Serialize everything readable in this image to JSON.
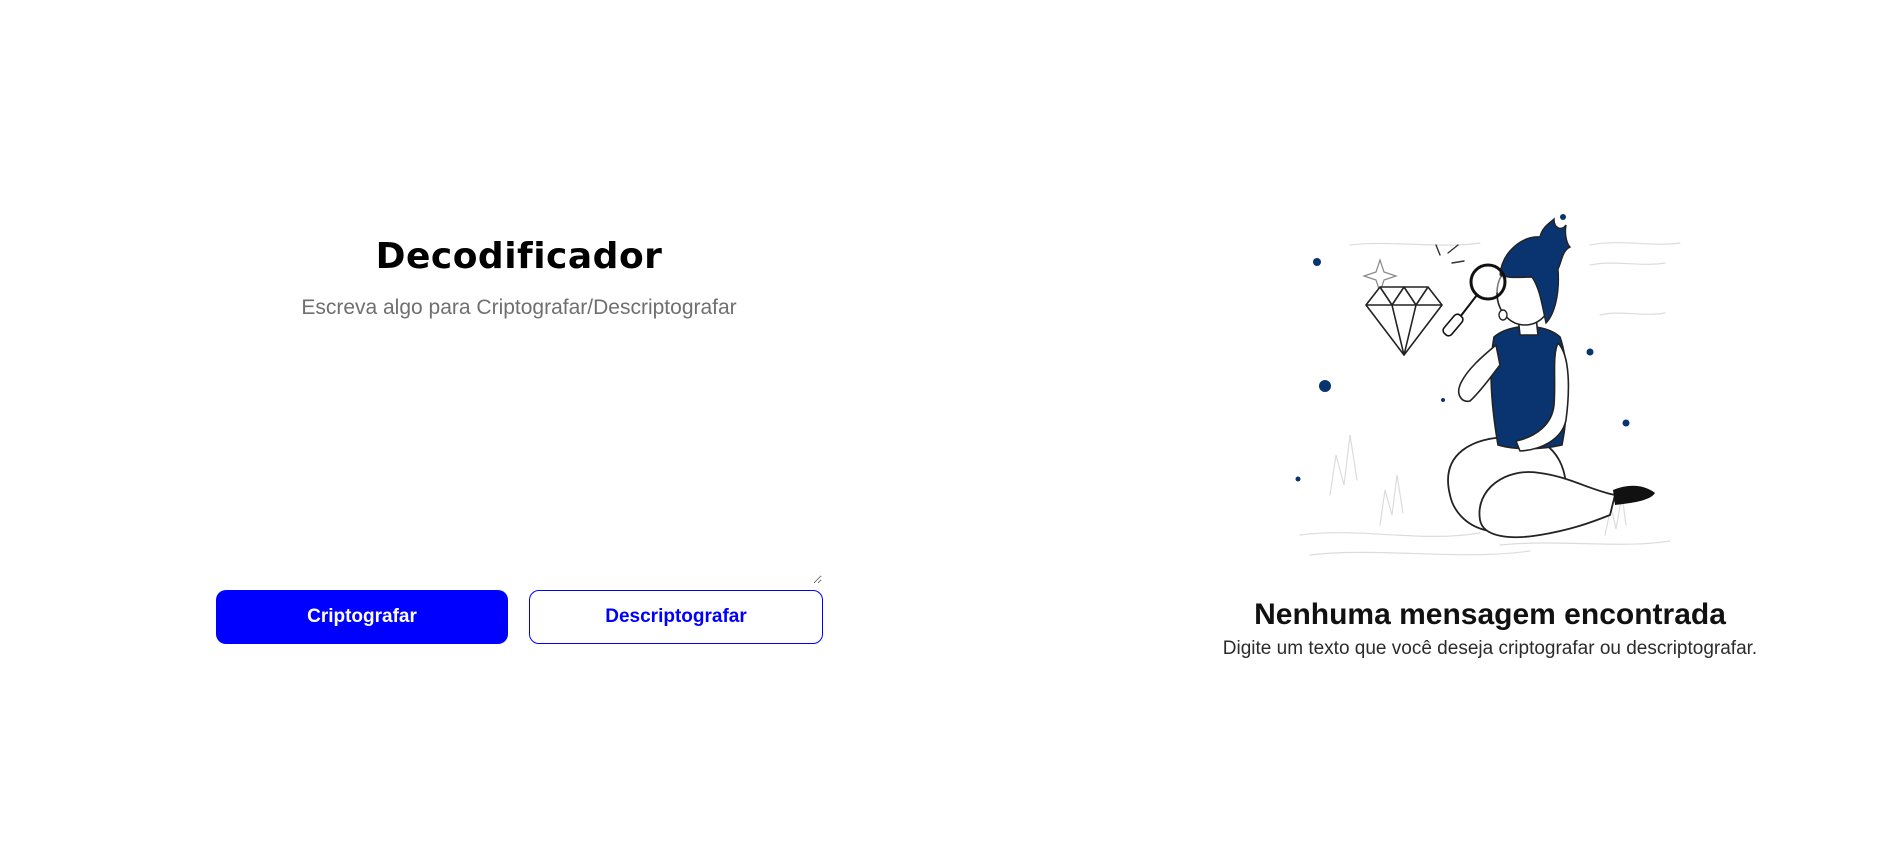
{
  "app": {
    "title": "Decodificador"
  },
  "input": {
    "placeholder": "Escreva algo para Criptografar/Descriptografar",
    "value": ""
  },
  "actions": {
    "encrypt_label": "Criptografar",
    "decrypt_label": "Descriptografar"
  },
  "output": {
    "empty_title": "Nenhuma mensagem encontrada",
    "empty_text": "Digite um texto que você deseja criptografar ou descriptografar.",
    "illustration_icon": "person-magnifier-diamond-illustration"
  },
  "colors": {
    "accent": "#0000ff",
    "illustration_blue": "#0a3470",
    "text_primary": "#000000",
    "text_muted": "#6f6f6f"
  }
}
